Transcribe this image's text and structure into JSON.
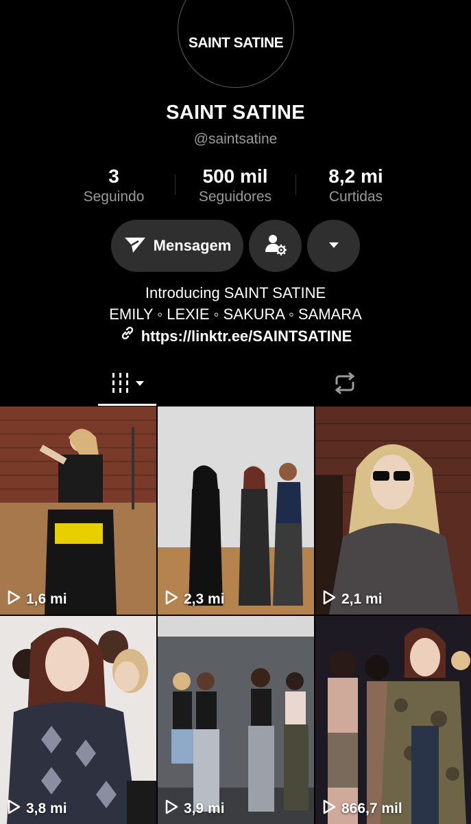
{
  "profile": {
    "avatar_text": "SAINT SATINE",
    "display_name": "SAINT SATINE",
    "handle": "@saintsatine"
  },
  "stats": [
    {
      "value": "3",
      "label": "Seguindo"
    },
    {
      "value": "500 mil",
      "label": "Seguidores"
    },
    {
      "value": "8,2 mi",
      "label": "Curtidas"
    }
  ],
  "actions": {
    "message_label": "Mensagem"
  },
  "bio": {
    "line1": "Introducing SAINT SATINE",
    "line2": "EMILY ◦ LEXIE ◦ SAKURA ◦ SAMARA",
    "link": "https://linktr.ee/SAINTSATINE"
  },
  "icons": {
    "message": "paper-plane-icon",
    "friends": "person-settings-icon",
    "more": "caret-down-icon",
    "link": "link-icon",
    "videos_tab": "grid-icon",
    "reposts_tab": "repost-icon",
    "play": "play-icon"
  },
  "videos": [
    {
      "views": "1,6 mi"
    },
    {
      "views": "2,3 mi"
    },
    {
      "views": "2,1 mi"
    },
    {
      "views": "3,8 mi"
    },
    {
      "views": "3,9 mi"
    },
    {
      "views": "866,7 mil"
    }
  ],
  "colors": {
    "background": "#000000",
    "button": "#2f2f2f",
    "muted_text": "#9a9a9a"
  }
}
